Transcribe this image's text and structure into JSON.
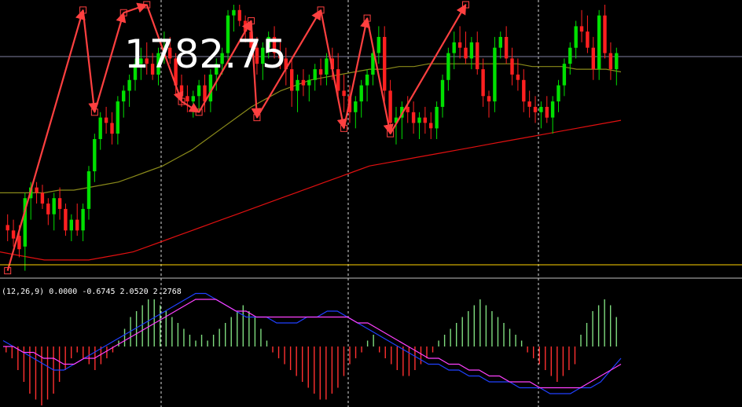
{
  "price_label": "1782.75",
  "indicator_label": "(12,26,9) 0.0000 -0.6745 2.0520 2.2768",
  "colors": {
    "background": "#000000",
    "bull": "#00e000",
    "bear": "#ff2020",
    "zigzag": "#ff4040",
    "ma_short": "#8a8a1a",
    "ma_long": "#e01010",
    "support": "#ffd400",
    "hist_pos": "#7fdc7f",
    "hist_neg": "#ff3030",
    "macd_line": "#2040ff",
    "signal_line": "#ff40ff",
    "grid": "#ffffff"
  },
  "chart_data": [
    {
      "type": "candlestick",
      "title": "",
      "price_marker_value": 1782.75,
      "ylim": [
        0,
        100
      ],
      "candles_ohlc": [
        [
          18,
          22,
          12,
          16
        ],
        [
          16,
          20,
          10,
          13
        ],
        [
          14,
          18,
          6,
          9
        ],
        [
          10,
          30,
          1,
          28
        ],
        [
          28,
          34,
          20,
          32
        ],
        [
          32,
          34,
          26,
          30
        ],
        [
          30,
          33,
          24,
          26
        ],
        [
          26,
          28,
          18,
          22
        ],
        [
          22,
          30,
          16,
          28
        ],
        [
          28,
          32,
          20,
          24
        ],
        [
          24,
          26,
          14,
          16
        ],
        [
          16,
          22,
          12,
          20
        ],
        [
          20,
          26,
          14,
          16
        ],
        [
          16,
          26,
          12,
          24
        ],
        [
          24,
          40,
          20,
          38
        ],
        [
          38,
          52,
          34,
          50
        ],
        [
          50,
          60,
          46,
          58
        ],
        [
          58,
          62,
          52,
          56
        ],
        [
          56,
          60,
          48,
          52
        ],
        [
          52,
          66,
          48,
          64
        ],
        [
          64,
          70,
          58,
          68
        ],
        [
          68,
          74,
          62,
          72
        ],
        [
          72,
          80,
          68,
          78
        ],
        [
          78,
          84,
          72,
          80
        ],
        [
          80,
          86,
          74,
          78
        ],
        [
          78,
          82,
          72,
          74
        ],
        [
          74,
          84,
          70,
          82
        ],
        [
          82,
          90,
          78,
          84
        ],
        [
          84,
          88,
          78,
          80
        ],
        [
          80,
          82,
          66,
          70
        ],
        [
          70,
          74,
          62,
          66
        ],
        [
          66,
          70,
          60,
          64
        ],
        [
          64,
          68,
          58,
          66
        ],
        [
          66,
          72,
          60,
          70
        ],
        [
          70,
          74,
          60,
          64
        ],
        [
          64,
          76,
          60,
          74
        ],
        [
          74,
          80,
          68,
          78
        ],
        [
          78,
          84,
          74,
          82
        ],
        [
          82,
          98,
          78,
          96
        ],
        [
          96,
          100,
          90,
          98
        ],
        [
          98,
          100,
          92,
          94
        ],
        [
          94,
          96,
          86,
          90
        ],
        [
          90,
          92,
          82,
          84
        ],
        [
          84,
          88,
          74,
          78
        ],
        [
          78,
          86,
          72,
          84
        ],
        [
          84,
          90,
          80,
          88
        ],
        [
          88,
          92,
          80,
          82
        ],
        [
          82,
          86,
          76,
          80
        ],
        [
          80,
          84,
          70,
          76
        ],
        [
          76,
          80,
          62,
          68
        ],
        [
          68,
          74,
          60,
          72
        ],
        [
          72,
          76,
          66,
          70
        ],
        [
          70,
          74,
          64,
          72
        ],
        [
          72,
          78,
          68,
          76
        ],
        [
          76,
          80,
          70,
          74
        ],
        [
          74,
          82,
          70,
          80
        ],
        [
          80,
          84,
          72,
          76
        ],
        [
          76,
          82,
          66,
          68
        ],
        [
          68,
          74,
          60,
          66
        ],
        [
          66,
          70,
          56,
          60
        ],
        [
          60,
          66,
          54,
          64
        ],
        [
          64,
          72,
          58,
          70
        ],
        [
          70,
          76,
          64,
          74
        ],
        [
          74,
          84,
          70,
          82
        ],
        [
          82,
          92,
          78,
          88
        ],
        [
          88,
          92,
          64,
          68
        ],
        [
          68,
          72,
          52,
          56
        ],
        [
          56,
          62,
          48,
          58
        ],
        [
          58,
          64,
          50,
          62
        ],
        [
          62,
          66,
          56,
          60
        ],
        [
          60,
          64,
          52,
          56
        ],
        [
          56,
          60,
          50,
          58
        ],
        [
          58,
          62,
          52,
          56
        ],
        [
          56,
          60,
          50,
          54
        ],
        [
          54,
          64,
          50,
          62
        ],
        [
          62,
          74,
          58,
          72
        ],
        [
          72,
          84,
          68,
          82
        ],
        [
          82,
          90,
          76,
          86
        ],
        [
          86,
          92,
          80,
          84
        ],
        [
          84,
          90,
          78,
          80
        ],
        [
          80,
          88,
          76,
          86
        ],
        [
          86,
          90,
          74,
          76
        ],
        [
          76,
          80,
          62,
          66
        ],
        [
          66,
          68,
          58,
          64
        ],
        [
          64,
          88,
          60,
          84
        ],
        [
          84,
          90,
          80,
          88
        ],
        [
          88,
          92,
          78,
          80
        ],
        [
          80,
          84,
          70,
          74
        ],
        [
          74,
          80,
          68,
          72
        ],
        [
          72,
          76,
          60,
          64
        ],
        [
          64,
          68,
          58,
          62
        ],
        [
          62,
          66,
          56,
          60
        ],
        [
          60,
          64,
          54,
          62
        ],
        [
          62,
          66,
          56,
          58
        ],
        [
          58,
          66,
          52,
          64
        ],
        [
          64,
          72,
          60,
          70
        ],
        [
          70,
          80,
          66,
          78
        ],
        [
          78,
          86,
          74,
          84
        ],
        [
          84,
          94,
          80,
          92
        ],
        [
          92,
          98,
          86,
          90
        ],
        [
          90,
          96,
          82,
          84
        ],
        [
          84,
          88,
          72,
          76
        ],
        [
          76,
          98,
          72,
          96
        ],
        [
          96,
          100,
          80,
          82
        ],
        [
          82,
          86,
          72,
          76
        ],
        [
          76,
          84,
          70,
          82
        ]
      ],
      "zigzag_points": [
        [
          0,
          1
        ],
        [
          13,
          98
        ],
        [
          15,
          60
        ],
        [
          20,
          97
        ],
        [
          24,
          100
        ],
        [
          30,
          64
        ],
        [
          33,
          60
        ],
        [
          42,
          94
        ],
        [
          43,
          58
        ],
        [
          54,
          98
        ],
        [
          58,
          54
        ],
        [
          62,
          95
        ],
        [
          66,
          52
        ],
        [
          79,
          100
        ]
      ],
      "ma_short_values": [
        30,
        30,
        30,
        30,
        31,
        31,
        32,
        33,
        34,
        36,
        38,
        40,
        43,
        46,
        50,
        54,
        58,
        62,
        65,
        68,
        70,
        72,
        73,
        74,
        75,
        76,
        76,
        77,
        77,
        78,
        78,
        78,
        78,
        78,
        78,
        78,
        77,
        77,
        77,
        76,
        76,
        76,
        75
      ],
      "ma_long_values": [
        8,
        7,
        6,
        5,
        5,
        5,
        5,
        6,
        7,
        8,
        10,
        12,
        14,
        16,
        18,
        20,
        22,
        24,
        26,
        28,
        30,
        32,
        34,
        36,
        38,
        40,
        41,
        42,
        43,
        44,
        45,
        46,
        47,
        48,
        49,
        50,
        51,
        52,
        53,
        54,
        55,
        56,
        57
      ]
    },
    {
      "type": "macd",
      "title": "",
      "ylim": [
        -10,
        10
      ],
      "histogram_values": [
        -1,
        -2,
        -4,
        -6,
        -8,
        -9,
        -10,
        -9,
        -8,
        -6,
        -4,
        -2,
        -1,
        -2,
        -3,
        -4,
        -3,
        -2,
        -1,
        1,
        3,
        5,
        6,
        7,
        8,
        8,
        7,
        6,
        5,
        4,
        3,
        2,
        1,
        2,
        1,
        2,
        3,
        4,
        5,
        6,
        7,
        6,
        5,
        3,
        1,
        -1,
        -2,
        -3,
        -4,
        -5,
        -6,
        -7,
        -8,
        -9,
        -9,
        -8,
        -7,
        -5,
        -3,
        -2,
        -1,
        1,
        2,
        -1,
        -2,
        -3,
        -4,
        -5,
        -5,
        -4,
        -3,
        -2,
        -1,
        1,
        2,
        3,
        4,
        5,
        6,
        7,
        8,
        7,
        6,
        5,
        4,
        3,
        2,
        1,
        -1,
        -2,
        -3,
        -4,
        -5,
        -6,
        -5,
        -4,
        -3,
        2,
        4,
        6,
        7,
        8,
        7,
        5
      ],
      "macd_line": [
        1,
        0,
        -1,
        -2,
        -3,
        -4,
        -4,
        -3,
        -2,
        -1,
        0,
        1,
        2,
        3,
        4,
        5,
        6,
        7,
        8,
        9,
        9,
        8,
        7,
        6,
        5,
        5,
        5,
        4,
        4,
        4,
        5,
        5,
        6,
        6,
        5,
        4,
        3,
        2,
        1,
        0,
        -1,
        -2,
        -3,
        -3,
        -4,
        -4,
        -5,
        -5,
        -6,
        -6,
        -6,
        -7,
        -7,
        -7,
        -8,
        -8,
        -8,
        -7,
        -7,
        -6,
        -4,
        -2
      ],
      "signal_line": [
        0,
        0,
        -1,
        -1,
        -2,
        -2,
        -3,
        -3,
        -2,
        -2,
        -1,
        0,
        1,
        2,
        3,
        4,
        5,
        6,
        7,
        8,
        8,
        8,
        7,
        6,
        6,
        5,
        5,
        5,
        5,
        5,
        5,
        5,
        5,
        5,
        5,
        4,
        4,
        3,
        2,
        1,
        0,
        -1,
        -2,
        -2,
        -3,
        -3,
        -4,
        -4,
        -5,
        -5,
        -6,
        -6,
        -6,
        -7,
        -7,
        -7,
        -7,
        -7,
        -6,
        -5,
        -4,
        -3
      ]
    }
  ]
}
